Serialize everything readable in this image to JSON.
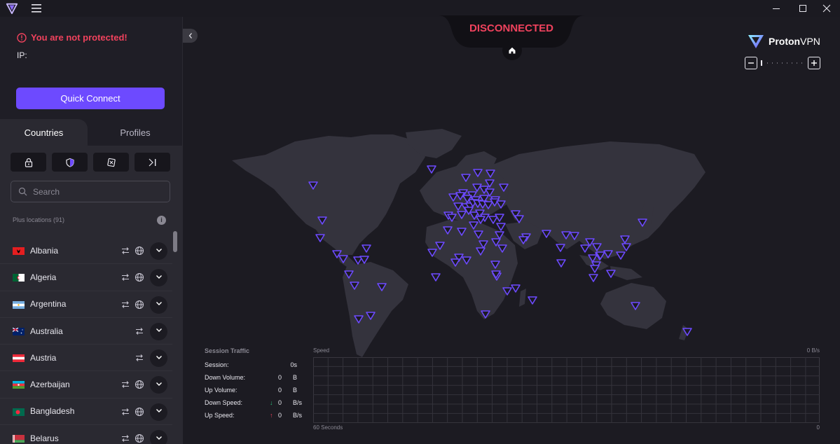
{
  "titlebar": {
    "icons": [
      "proton-logo-icon",
      "hamburger-menu-icon",
      "minimize-icon",
      "maximize-icon",
      "close-icon"
    ]
  },
  "sidebar": {
    "status": "You are not protected!",
    "ip_label": "IP:",
    "quick_connect": "Quick Connect",
    "tabs": [
      {
        "label": "Countries"
      },
      {
        "label": "Profiles"
      }
    ],
    "filters": [
      "lock-icon",
      "shield-icon",
      "secure-core-icon",
      "split-tunnel-icon"
    ],
    "search_placeholder": "Search",
    "section_label": "Plus locations (91)",
    "countries": [
      {
        "name": "Albania",
        "flag": "al",
        "secure_core": false,
        "tor": true
      },
      {
        "name": "Algeria",
        "flag": "dz",
        "secure_core": false,
        "tor": true
      },
      {
        "name": "Argentina",
        "flag": "ar",
        "secure_core": false,
        "tor": true
      },
      {
        "name": "Australia",
        "flag": "au",
        "secure_core": true,
        "tor": false
      },
      {
        "name": "Austria",
        "flag": "at",
        "secure_core": true,
        "tor": false
      },
      {
        "name": "Azerbaijan",
        "flag": "az",
        "secure_core": false,
        "tor": true
      },
      {
        "name": "Bangladesh",
        "flag": "bd",
        "secure_core": false,
        "tor": true
      },
      {
        "name": "Belarus",
        "flag": "by",
        "secure_core": false,
        "tor": true
      }
    ]
  },
  "map": {
    "status": "DISCONNECTED",
    "brand_1": "Proton",
    "brand_2": "VPN",
    "accent": "#6d4aff",
    "danger": "#f0425d"
  },
  "traffic": {
    "title": "Session Traffic",
    "rows": [
      {
        "label": "Session:",
        "value": "0s",
        "unit": "",
        "arrow": ""
      },
      {
        "label": "Down Volume:",
        "value": "0",
        "unit": "B",
        "arrow": ""
      },
      {
        "label": "Up Volume:",
        "value": "0",
        "unit": "B",
        "arrow": ""
      },
      {
        "label": "Down Speed:",
        "value": "0",
        "unit": "B/s",
        "arrow": "↓"
      },
      {
        "label": "Up Speed:",
        "value": "0",
        "unit": "B/s",
        "arrow": "↑"
      }
    ],
    "graph_title": "Speed",
    "graph_max": "0  B/s",
    "graph_time": "60 Seconds",
    "graph_zero": "0"
  }
}
